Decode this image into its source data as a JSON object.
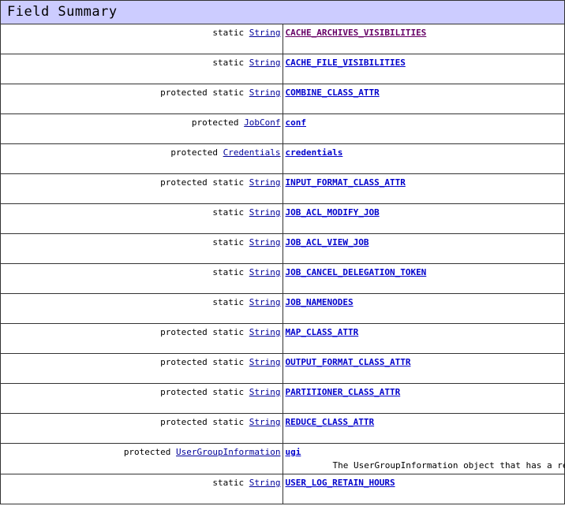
{
  "summary": {
    "title": "Field Summary",
    "columns": [
      "modifier-and-type",
      "field-and-description"
    ],
    "rows": [
      {
        "modifier": "static String",
        "modifier_parts": [
          "static ",
          "String"
        ],
        "type_link": "String",
        "prefix": "static",
        "field": "CACHE_ARCHIVES_VISIBILITIES",
        "field_state": "visited",
        "description": ""
      },
      {
        "modifier": "static String",
        "modifier_parts": [
          "static ",
          "String"
        ],
        "type_link": "String",
        "prefix": "static",
        "field": "CACHE_FILE_VISIBILITIES",
        "field_state": "link",
        "description": ""
      },
      {
        "modifier": "protected static String",
        "modifier_parts": [
          "protected static ",
          "String"
        ],
        "type_link": "String",
        "prefix": "protected static",
        "field": "COMBINE_CLASS_ATTR",
        "field_state": "link",
        "description": ""
      },
      {
        "modifier": "protected JobConf",
        "modifier_parts": [
          "protected ",
          "JobConf"
        ],
        "type_link": "JobConf",
        "prefix": "protected",
        "field": "conf",
        "field_state": "link",
        "description": ""
      },
      {
        "modifier": "protected Credentials",
        "modifier_parts": [
          "protected ",
          "Credentials"
        ],
        "type_link": "Credentials",
        "prefix": "protected",
        "field": "credentials",
        "field_state": "link",
        "description": ""
      },
      {
        "modifier": "protected static String",
        "modifier_parts": [
          "protected static ",
          "String"
        ],
        "type_link": "String",
        "prefix": "protected static",
        "field": "INPUT_FORMAT_CLASS_ATTR",
        "field_state": "link",
        "description": ""
      },
      {
        "modifier": "static String",
        "modifier_parts": [
          "static ",
          "String"
        ],
        "type_link": "String",
        "prefix": "static",
        "field": "JOB_ACL_MODIFY_JOB",
        "field_state": "link",
        "description": ""
      },
      {
        "modifier": "static String",
        "modifier_parts": [
          "static ",
          "String"
        ],
        "type_link": "String",
        "prefix": "static",
        "field": "JOB_ACL_VIEW_JOB",
        "field_state": "link",
        "description": ""
      },
      {
        "modifier": "static String",
        "modifier_parts": [
          "static ",
          "String"
        ],
        "type_link": "String",
        "prefix": "static",
        "field": "JOB_CANCEL_DELEGATION_TOKEN",
        "field_state": "link",
        "description": ""
      },
      {
        "modifier": "static String",
        "modifier_parts": [
          "static ",
          "String"
        ],
        "type_link": "String",
        "prefix": "static",
        "field": "JOB_NAMENODES",
        "field_state": "link",
        "description": ""
      },
      {
        "modifier": "protected static String",
        "modifier_parts": [
          "protected static ",
          "String"
        ],
        "type_link": "String",
        "prefix": "protected static",
        "field": "MAP_CLASS_ATTR",
        "field_state": "link",
        "description": ""
      },
      {
        "modifier": "protected static String",
        "modifier_parts": [
          "protected static ",
          "String"
        ],
        "type_link": "String",
        "prefix": "protected static",
        "field": "OUTPUT_FORMAT_CLASS_ATTR",
        "field_state": "link",
        "description": ""
      },
      {
        "modifier": "protected static String",
        "modifier_parts": [
          "protected static ",
          "String"
        ],
        "type_link": "String",
        "prefix": "protected static",
        "field": "PARTITIONER_CLASS_ATTR",
        "field_state": "link",
        "description": ""
      },
      {
        "modifier": "protected static String",
        "modifier_parts": [
          "protected static ",
          "String"
        ],
        "type_link": "String",
        "prefix": "protected static",
        "field": "REDUCE_CLASS_ATTR",
        "field_state": "link",
        "description": ""
      },
      {
        "modifier": "protected UserGroupInformation",
        "modifier_parts": [
          "protected ",
          "UserGroupInformation"
        ],
        "type_link": "UserGroupInformation",
        "prefix": "protected",
        "field": "ugi",
        "field_state": "link",
        "description": "The UserGroupInformation object that has a reference to the current user"
      },
      {
        "modifier": "static String",
        "modifier_parts": [
          "static ",
          "String"
        ],
        "type_link": "String",
        "prefix": "static",
        "field": "USER_LOG_RETAIN_HOURS",
        "field_state": "link",
        "description": ""
      }
    ]
  },
  "colors": {
    "caption_background": "#ccccff",
    "border": "#333333",
    "link": "#0000cc",
    "visited_link": "#660066",
    "type_link": "#000099",
    "text": "#000000",
    "page_background": "#ffffff"
  }
}
